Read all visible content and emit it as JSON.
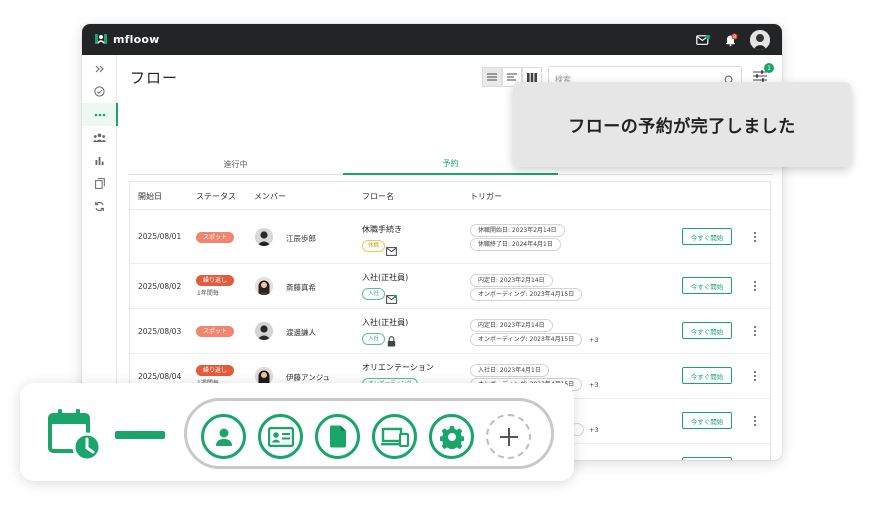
{
  "app": {
    "brand": "mfloow"
  },
  "header": {
    "notification_badge": "8"
  },
  "page": {
    "title": "フロー"
  },
  "search": {
    "placeholder": "検索"
  },
  "filter": {
    "badge": "1"
  },
  "tabs": [
    {
      "label": "進行中"
    },
    {
      "label": "予約"
    }
  ],
  "table": {
    "columns": [
      "開始日",
      "ステータス",
      "メンバー",
      "フロー名",
      "トリガー"
    ],
    "start_label": "今すぐ開始",
    "rows": [
      {
        "date": "2025/08/01",
        "status": "スポット",
        "status_type": "spot",
        "substatus": "",
        "member": "江辰歩郎",
        "flow": "休職手続き",
        "flow_tag": "休職",
        "flow_tag_color": "yellow",
        "flow_icon": "mail-icon",
        "triggers": [
          "休職開始日: 2023年2月14日",
          "休職終了日: 2024年4月1日"
        ],
        "more": ""
      },
      {
        "date": "2025/08/02",
        "status": "繰り返し",
        "status_type": "repeat",
        "substatus": "1年間毎",
        "member": "斎藤真希",
        "flow": "入社(正社員)",
        "flow_tag": "入社",
        "flow_tag_color": "green",
        "flow_icon": "mail-check-icon",
        "triggers": [
          "内定日: 2023年2月14日",
          "オンボーディング: 2023年4月15日"
        ],
        "more": ""
      },
      {
        "date": "2025/08/03",
        "status": "スポット",
        "status_type": "spot",
        "substatus": "",
        "member": "渡邊謙人",
        "flow": "入社(正社員)",
        "flow_tag": "入社",
        "flow_tag_color": "green",
        "flow_icon": "lock-icon",
        "triggers": [
          "内定日: 2023年2月14日",
          "オンボーディング: 2023年4月15日"
        ],
        "more": "+3"
      },
      {
        "date": "2025/08/04",
        "status": "繰り返し",
        "status_type": "repeat",
        "substatus": "1週間毎",
        "member": "伊藤アンジュ",
        "flow": "オリエンテーション",
        "flow_tag": "オンボーディング",
        "flow_tag_color": "green",
        "flow_icon": "",
        "triggers": [
          "入社日: 2023年4月1日",
          "オンボーディング: 2023年4月15日"
        ],
        "more": "+3"
      },
      {
        "date": "",
        "status": "",
        "status_type": "",
        "substatus": "",
        "member": "",
        "flow": "",
        "flow_tag": "",
        "flow_tag_color": "",
        "flow_icon": "",
        "triggers": [],
        "more": "+3"
      },
      {
        "date": "",
        "status": "",
        "status_type": "",
        "substatus": "",
        "member": "",
        "flow": "",
        "flow_tag": "",
        "flow_tag_color": "",
        "flow_icon": "",
        "triggers": [],
        "more": "+3"
      }
    ]
  },
  "toast": {
    "message": "フローの予約が完了しました"
  },
  "colors": {
    "accent": "#1aa56b",
    "spot": "#f2856d",
    "repeat": "#e45a3c",
    "topbar": "#222426"
  },
  "flow_icons": [
    "person-icon",
    "id-card-icon",
    "document-icon",
    "devices-icon",
    "gear-icon",
    "plus-icon"
  ]
}
